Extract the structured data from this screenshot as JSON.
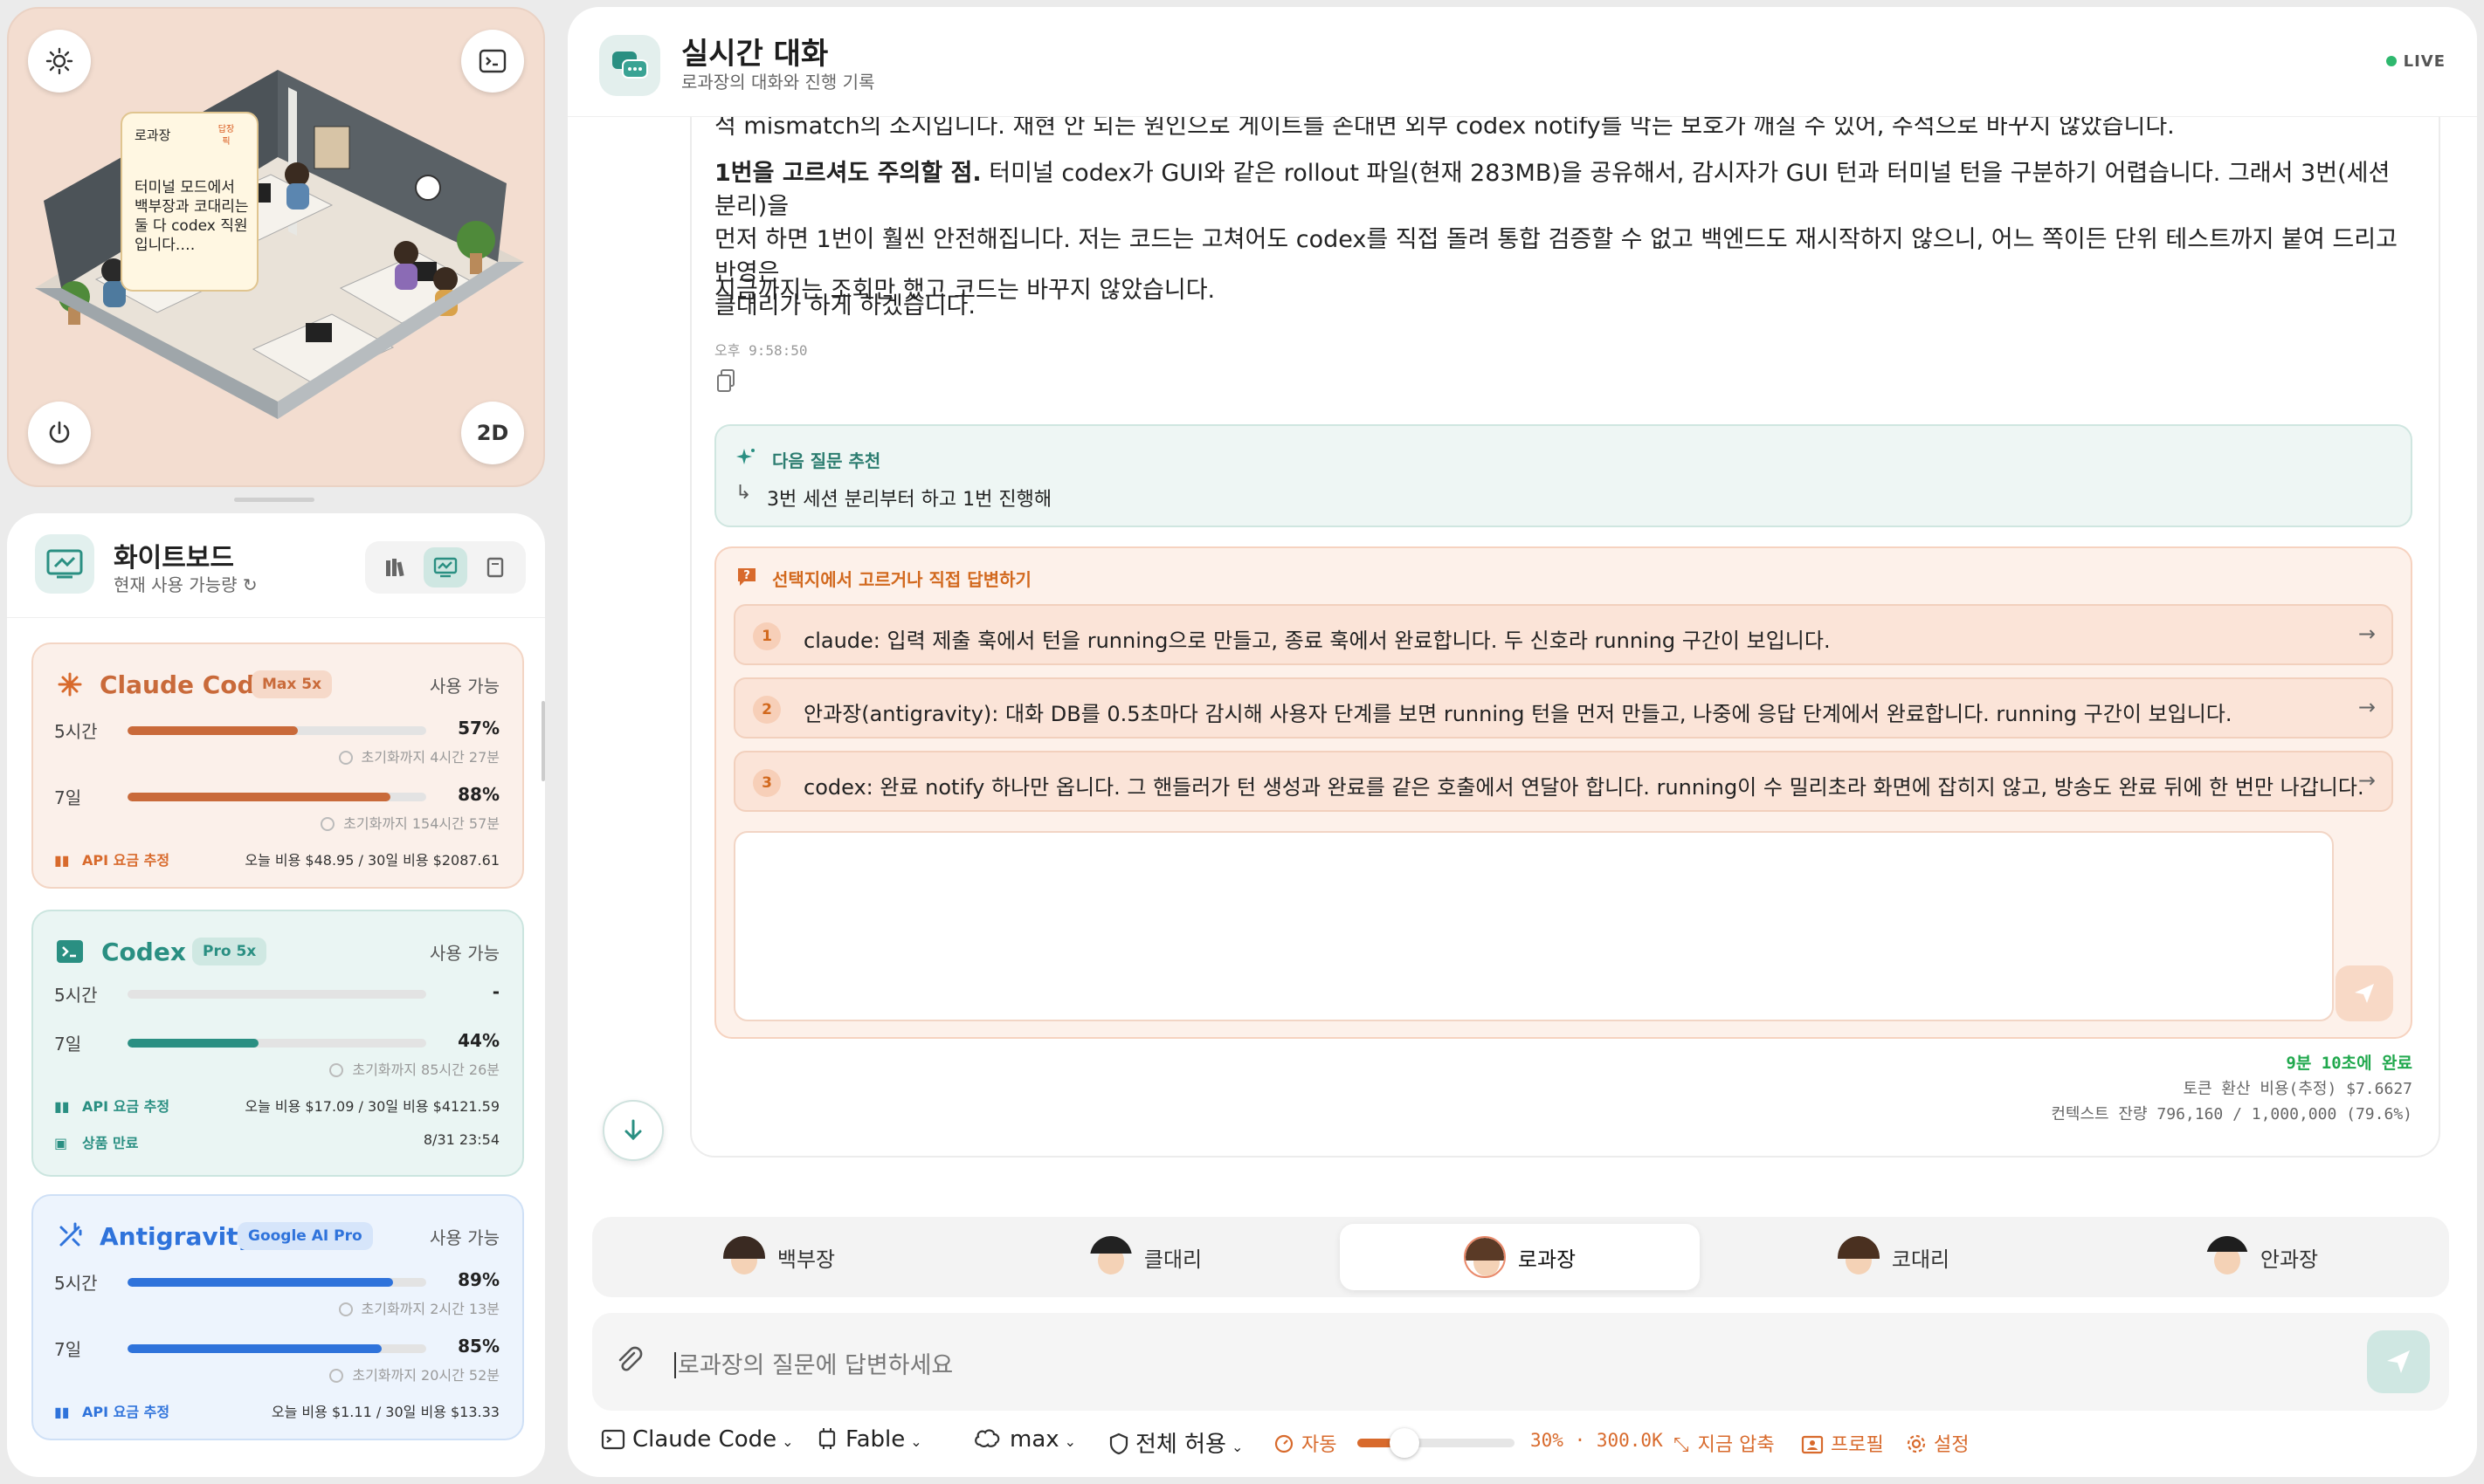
{
  "scene": {
    "speech": {
      "speaker": "로과장",
      "tag": "답장픽",
      "text": "터미널 모드에서 백부장과 코대리는 둘 다 codex 직원입니다.…"
    },
    "view_mode": "2D"
  },
  "whiteboard": {
    "title": "화이트보드",
    "subtitle": "현재 사용 가능량",
    "cards": [
      {
        "name": "Claude Code",
        "badge": "Max 5x",
        "available": "사용 가능",
        "rows": [
          {
            "label": "5시간",
            "percent": 57,
            "value": "57%",
            "reset": "초기화까지 4시간 27분"
          },
          {
            "label": "7일",
            "percent": 88,
            "value": "88%",
            "reset": "초기화까지 154시간 57분"
          }
        ],
        "api_label": "API 요금 추정",
        "api_value": "오늘 비용 $48.95 / 30일 비용 $2087.61"
      },
      {
        "name": "Codex",
        "badge": "Pro 5x",
        "available": "사용 가능",
        "rows": [
          {
            "label": "5시간",
            "percent": 0,
            "value": "-",
            "reset": ""
          },
          {
            "label": "7일",
            "percent": 44,
            "value": "44%",
            "reset": "초기화까지 85시간 26분"
          }
        ],
        "api_label": "API 요금 추정",
        "api_value": "오늘 비용 $17.09 / 30일 비용 $4121.59",
        "expiry_label": "상품 만료",
        "expiry_value": "8/31 23:54"
      },
      {
        "name": "Antigravity",
        "badge": "Google AI Pro",
        "available": "사용 가능",
        "rows": [
          {
            "label": "5시간",
            "percent": 89,
            "value": "89%",
            "reset": "초기화까지 2시간 13분"
          },
          {
            "label": "7일",
            "percent": 85,
            "value": "85%",
            "reset": "초기화까지 20시간 52분"
          }
        ],
        "api_label": "API 요금 추정",
        "api_value": "오늘 비용 $1.11 / 30일 비용 $13.33"
      }
    ]
  },
  "chat": {
    "title": "실시간 대화",
    "subtitle": "로과장의 대화와 진행 기록",
    "live": "LIVE",
    "message": {
      "p0": "적 mismatch의 소지입니다. 재현 안 되는 원인으로 게이트를 손대면 외부 codex notify를 막는 보호가 깨질 수 있어, 주석으로 바꾸지 않았습니다.",
      "p1_bold": "1번을 고르셔도 주의할 점.",
      "p1_line1": " 터미널 codex가 GUI와 같은 rollout 파일(현재 283MB)을 공유해서, 감시자가 GUI 턴과 터미널 턴을 구분하기 어렵습니다. 그래서 3번(세션 분리)을",
      "p1_line2": "먼저 하면 1번이 훨씬 안전해집니다. 저는 코드는 고쳐어도 codex를 직접 돌려 통합 검증할 수 없고 백엔드도 재시작하지 않으니, 어느 쪽이든 단위 테스트까지 붙여 드리고 반영은",
      "p1_line3": "클대리가 하게 하겠습니다.",
      "p2": "지금까지는 조회만 했고 코드는 바꾸지 않았습니다.",
      "time": "오후 9:58:50"
    },
    "suggestion": {
      "title": "다음 질문 추천",
      "text": "3번 세션 분리부터 하고 1번 진행해"
    },
    "choice": {
      "title": "선택지에서 고르거나 직접 답변하기",
      "options": [
        {
          "num": "1",
          "text": "claude: 입력 제출 훅에서 턴을 running으로 만들고, 종료 훅에서 완료합니다. 두 신호라 running 구간이 보입니다."
        },
        {
          "num": "2",
          "text": "안과장(antigravity): 대화 DB를 0.5초마다 감시해 사용자 단계를 보면 running 턴을 먼저 만들고, 나중에 응답 단계에서 완료합니다. running 구간이 보입니다."
        },
        {
          "num": "3",
          "text": "codex: 완료 notify 하나만 옵니다. 그 핸들러가 턴 생성과 완료를 같은 호출에서 연달아 합니다. running이 수 밀리초라 화면에 잡히지 않고, 방송도 완료 뒤에 한 번만 나갑니다."
        }
      ]
    },
    "stats": {
      "done": "9분 10초에 완료",
      "cost": "토큰 환산 비용(추정) $7.6627",
      "context": "컨텍스트 잔량 796,160 / 1,000,000 (79.6%)"
    },
    "agents": [
      {
        "name": "백부장",
        "active": false
      },
      {
        "name": "클대리",
        "active": false
      },
      {
        "name": "로과장",
        "active": true
      },
      {
        "name": "코대리",
        "active": false
      },
      {
        "name": "안과장",
        "active": false
      }
    ],
    "input_placeholder": "로과장의 질문에 답변하세요",
    "toolbar": {
      "model": "Claude Code",
      "persona": "Fable",
      "effort": "max",
      "permission": "전체 허용",
      "auto": "자동",
      "slider_percent": 30,
      "compress_info": "30% · 300.0K",
      "compress_now": "지금 압축",
      "profile": "프로필",
      "settings": "설정"
    }
  },
  "colors": {
    "claude": "#c96a3a",
    "codex": "#2a8f82",
    "antigravity": "#2f73db",
    "accent_orange": "#d86a2c",
    "live_green": "#2eb86e"
  }
}
